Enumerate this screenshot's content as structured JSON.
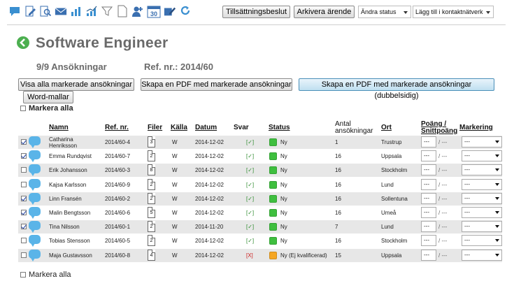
{
  "toolbar": {
    "icons": [
      "chat-icon",
      "edit-document-icon",
      "search-document-icon",
      "envelope-icon",
      "bar-chart-icon",
      "line-chart-icon",
      "funnel-icon",
      "blank-document-icon",
      "add-user-icon",
      "calendar-icon",
      "edit-icon",
      "refresh-icon"
    ],
    "calendar_day": "30",
    "buttons": {
      "decision": "Tillsättningsbeslut",
      "archive": "Arkivera ärende"
    },
    "selects": {
      "status": "Ändra status",
      "network": "Lägg till i kontaktnätverk"
    }
  },
  "header": {
    "title": "Software Engineer",
    "applications": "9/9 Ansökningar",
    "ref": "Ref. nr.: 2014/60"
  },
  "actions": {
    "show_all": "Visa alla markerade ansökningar",
    "pdf": "Skapa en PDF med markerade ansökningar",
    "pdf_duplex": "Skapa en PDF med markerade ansökningar (dubbelsidig)",
    "word": "Word-mallar",
    "mark_all": "Markera alla"
  },
  "table": {
    "headers": {
      "name": "Namn",
      "ref": "Ref. nr.",
      "files": "Filer",
      "source": "Källa",
      "date": "Datum",
      "answer": "Svar",
      "status": "Status",
      "count_line1": "Antal",
      "count_line2": "ansökningar",
      "city": "Ort",
      "points_line1": "Poäng /",
      "points_line2": "Snittpoäng",
      "marking": "Markering"
    },
    "rows": [
      {
        "checked": true,
        "name": "Catharina Henriksson",
        "ref": "2014/60-4",
        "files": "3",
        "source": "W",
        "date": "2014-12-02",
        "answer": "[✓]",
        "status": "Ny",
        "status_color": "#3fbf3f",
        "count": "1",
        "city": "Trustrup",
        "points": "---",
        "avg": "/ ---",
        "marking": "---"
      },
      {
        "checked": true,
        "name": "Emma Rundqvist",
        "ref": "2014/60-7",
        "files": "2",
        "source": "W",
        "date": "2014-12-02",
        "answer": "[✓]",
        "status": "Ny",
        "status_color": "#3fbf3f",
        "count": "16",
        "city": "Uppsala",
        "points": "---",
        "avg": "/ ---",
        "marking": "---"
      },
      {
        "checked": false,
        "name": "Erik Johansson",
        "ref": "2014/60-3",
        "files": "8",
        "source": "W",
        "date": "2014-12-02",
        "answer": "[✓]",
        "status": "Ny",
        "status_color": "#3fbf3f",
        "count": "16",
        "city": "Stockholm",
        "points": "---",
        "avg": "/ ---",
        "marking": "---"
      },
      {
        "checked": false,
        "name": "Kajsa Karlsson",
        "ref": "2014/60-9",
        "files": "2",
        "source": "W",
        "date": "2014-12-02",
        "answer": "[✓]",
        "status": "Ny",
        "status_color": "#3fbf3f",
        "count": "16",
        "city": "Lund",
        "points": "---",
        "avg": "/ ---",
        "marking": "---"
      },
      {
        "checked": true,
        "name": "Linn Fransén",
        "ref": "2014/60-2",
        "files": "2",
        "source": "W",
        "date": "2014-12-02",
        "answer": "[✓]",
        "status": "Ny",
        "status_color": "#3fbf3f",
        "count": "16",
        "city": "Sollentuna",
        "points": "---",
        "avg": "/ ---",
        "marking": "---"
      },
      {
        "checked": true,
        "name": "Malin Bengtsson",
        "ref": "2014/60-6",
        "files": "5",
        "source": "W",
        "date": "2014-12-02",
        "answer": "[✓]",
        "status": "Ny",
        "status_color": "#3fbf3f",
        "count": "16",
        "city": "Umeå",
        "points": "---",
        "avg": "/ ---",
        "marking": "---"
      },
      {
        "checked": true,
        "name": "Tina Nilsson",
        "ref": "2014/60-1",
        "files": "2",
        "source": "W",
        "date": "2014-11-20",
        "answer": "[✓]",
        "status": "Ny",
        "status_color": "#3fbf3f",
        "count": "7",
        "city": "Lund",
        "points": "---",
        "avg": "/ ---",
        "marking": "---"
      },
      {
        "checked": false,
        "name": "Tobias Stensson",
        "ref": "2014/60-5",
        "files": "2",
        "source": "W",
        "date": "2014-12-02",
        "answer": "[✓]",
        "status": "Ny",
        "status_color": "#3fbf3f",
        "count": "16",
        "city": "Stockholm",
        "points": "---",
        "avg": "/ ---",
        "marking": "---"
      },
      {
        "checked": false,
        "name": "Maja Gustavsson",
        "ref": "2014/60-8",
        "files": "4",
        "source": "W",
        "date": "2014-12-02",
        "answer": "[X]",
        "status": "Ny (Ej kvalificerad)",
        "status_color": "#f5a623",
        "count": "15",
        "city": "Uppsala",
        "points": "---",
        "avg": "/ ---",
        "marking": "---"
      }
    ]
  },
  "colors": {
    "answer_ok": "#2e8b2e",
    "answer_no": "#cc2222",
    "bubble": "#5ab4e8",
    "back": "#4caf50"
  }
}
